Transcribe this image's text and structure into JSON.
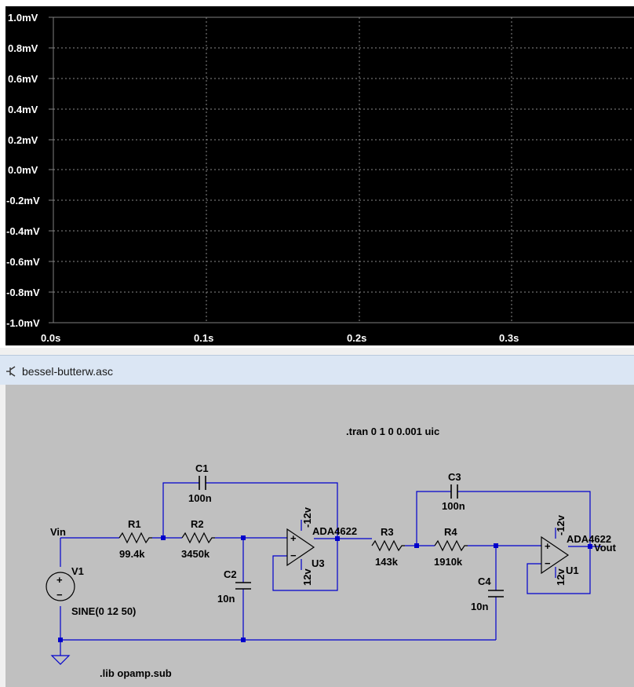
{
  "plot": {
    "y_ticks": [
      "1.0mV",
      "0.8mV",
      "0.6mV",
      "0.4mV",
      "0.2mV",
      "0.0mV",
      "-0.2mV",
      "-0.4mV",
      "-0.6mV",
      "-0.8mV",
      "-1.0mV"
    ],
    "x_ticks": [
      "0.0s",
      "0.1s",
      "0.2s",
      "0.3s"
    ],
    "background": "#000000",
    "grid_color": "#7f7f7f"
  },
  "tab": {
    "icon": "schematic-icon",
    "title": "bessel-butterw.asc"
  },
  "schematic": {
    "directive_tran": ".tran 0 1 0 0.001 uic",
    "directive_lib": ".lib opamp.sub",
    "wire_color": "#0000cc",
    "labels": {
      "vin": "Vin",
      "vout": "Vout",
      "v1_name": "V1",
      "v1_value": "SINE(0 12 50)",
      "r1_name": "R1",
      "r1_value": "99.4k",
      "r2_name": "R2",
      "r2_value": "3450k",
      "r3_name": "R3",
      "r3_value": "143k",
      "r4_name": "R4",
      "r4_value": "1910k",
      "c1_name": "C1",
      "c1_value": "100n",
      "c2_name": "C2",
      "c2_value": "10n",
      "c3_name": "C3",
      "c3_value": "100n",
      "c4_name": "C4",
      "c4_value": "10n",
      "u3_name": "U3",
      "u3_model": "ADA4622",
      "u1_name": "U1",
      "u1_model": "ADA4622",
      "u3_pos_supply": "12v",
      "u3_neg_supply": "-12v",
      "u1_pos_supply": "12v",
      "u1_neg_supply": "-12v",
      "plus": "+",
      "minus": "−"
    }
  }
}
